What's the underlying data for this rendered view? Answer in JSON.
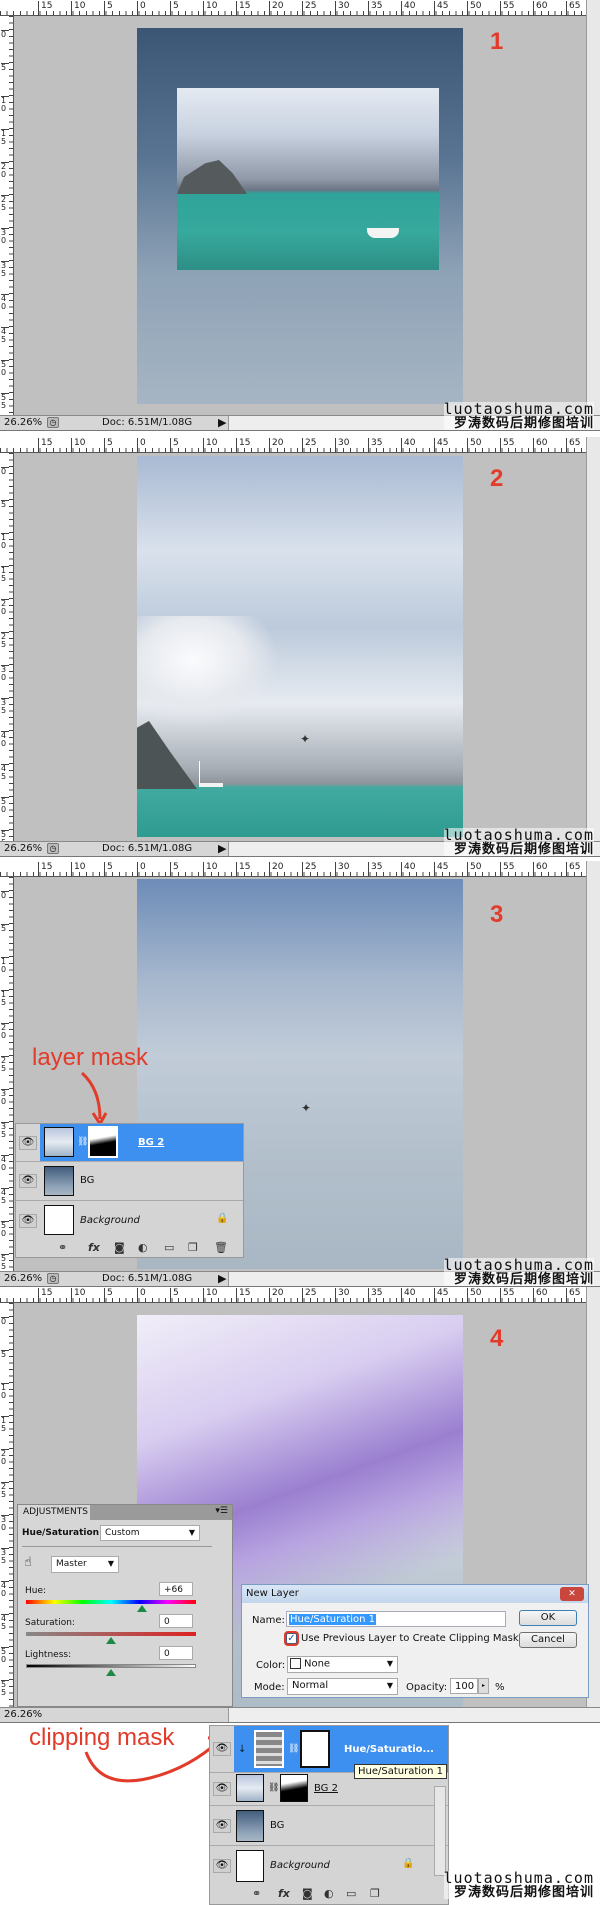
{
  "ruler": {
    "top_labels": [
      "15",
      "10",
      "5",
      "0",
      "5",
      "10",
      "15",
      "20",
      "25",
      "30",
      "35",
      "40",
      "45",
      "50",
      "55",
      "60",
      "65"
    ],
    "left_labels": [
      "0",
      "5",
      "10",
      "15",
      "20",
      "25",
      "30",
      "35",
      "40",
      "45",
      "50",
      "55"
    ]
  },
  "status": {
    "zoom": "26.26%",
    "doc": "Doc: 6.51M/1.08G",
    "play_icon": "▶",
    "scroll_left_icon": "‹"
  },
  "watermark": {
    "line1": "luotaoshuma.com",
    "line2": "罗涛数码后期修图培训"
  },
  "steps": [
    "1",
    "2",
    "3",
    "4"
  ],
  "annotations": {
    "layer_mask": "layer mask",
    "clipping_mask": "clipping mask"
  },
  "accent_color": "#e23b2a",
  "selection_color": "#3d8ff0",
  "layers_step3": {
    "rows": [
      {
        "name": "BG 2",
        "selected": true,
        "has_mask": true
      },
      {
        "name": "BG",
        "selected": false
      },
      {
        "name": "Background",
        "selected": false,
        "locked": true
      }
    ],
    "footer_icons": [
      "link-icon",
      "fx-icon",
      "mask-icon",
      "adjustment-icon",
      "folder-icon",
      "new-layer-icon",
      "trash-icon"
    ],
    "fx_label": "fx"
  },
  "layers_step4": {
    "rows": [
      {
        "name": "Hue/Saturatio...",
        "selected": true,
        "clipped": true
      },
      {
        "name": "BG 2",
        "selected": false,
        "has_mask": true
      },
      {
        "name": "BG",
        "selected": false
      },
      {
        "name": "Background",
        "selected": false,
        "locked": true
      }
    ],
    "tooltip": "Hue/Saturation 1",
    "fx_label": "fx"
  },
  "adjustments": {
    "tab": "ADJUSTMENTS",
    "title": "Hue/Saturation",
    "preset": "Custom",
    "channel": "Master",
    "sliders": [
      {
        "label": "Hue:",
        "value": "+66",
        "min": -180,
        "max": 180,
        "pos": 66
      },
      {
        "label": "Saturation:",
        "value": "0",
        "min": -100,
        "max": 100,
        "pos": 0
      },
      {
        "label": "Lightness:",
        "value": "0",
        "min": -100,
        "max": 100,
        "pos": 0
      }
    ]
  },
  "new_layer_dialog": {
    "title": "New Layer",
    "close": "✕",
    "name_label": "Name:",
    "name_value": "Hue/Saturation 1",
    "clip_checkbox_label": "Use Previous Layer to Create Clipping Mask",
    "clip_checked": true,
    "color_label": "Color:",
    "color_value": "None",
    "mode_label": "Mode:",
    "mode_value": "Normal",
    "opacity_label": "Opacity:",
    "opacity_value": "100",
    "opacity_unit": "%",
    "ok": "OK",
    "cancel": "Cancel"
  }
}
